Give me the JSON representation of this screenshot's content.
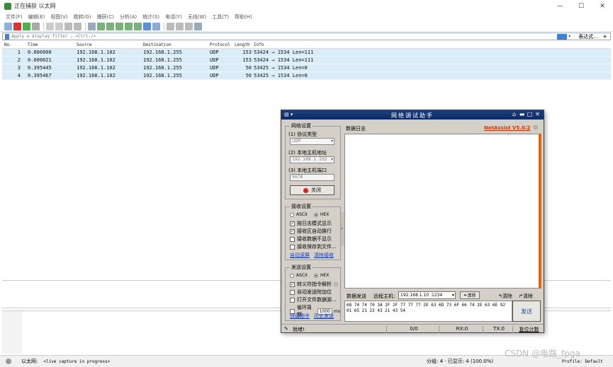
{
  "window": {
    "title": "正在捕获 以太网"
  },
  "menu": [
    "文件(F)",
    "编辑(E)",
    "视图(V)",
    "跳转(G)",
    "捕获(C)",
    "分析(A)",
    "统计(S)",
    "电话(Y)",
    "无线(W)",
    "工具(T)",
    "帮助(H)"
  ],
  "filter": {
    "placeholder": "Apply a display filter … <Ctrl-/>",
    "expr_label": "表达式…",
    "plus": "+"
  },
  "packet_list": {
    "columns": [
      "No.",
      "Time",
      "Source",
      "Destination",
      "Protocol",
      "Length",
      "Info"
    ],
    "rows": [
      {
        "no": "1",
        "time": "0.000000",
        "src": "192.168.1.102",
        "dst": "192.168.1.255",
        "proto": "UDP",
        "len": "153",
        "info": "53424 → 1534 Len=111"
      },
      {
        "no": "2",
        "time": "0.000021",
        "src": "192.168.1.102",
        "dst": "192.168.1.255",
        "proto": "UDP",
        "len": "153",
        "info": "53424 → 1534 Len=111"
      },
      {
        "no": "3",
        "time": "0.395445",
        "src": "192.168.1.102",
        "dst": "192.168.1.255",
        "proto": "UDP",
        "len": "50",
        "info": "53425 → 1534 Len=8"
      },
      {
        "no": "4",
        "time": "0.395467",
        "src": "192.168.1.102",
        "dst": "192.168.1.255",
        "proto": "UDP",
        "len": "50",
        "info": "53425 → 1534 Len=8"
      }
    ]
  },
  "status": {
    "interface": "以太网:",
    "capture": "<live capture in progress>",
    "stats": "分组: 4 · 已显示: 4 (100.0%)",
    "profile": "Profile: Default"
  },
  "watermark": "CSDN @电路_fpga",
  "netassist": {
    "title": "网络调试助手",
    "brand": "NetAssist V5.0.2",
    "net_settings": {
      "legend": "网络设置",
      "protocol_label": "(1) 协议类型",
      "protocol_value": "UDP",
      "local_ip_label": "(2) 本地主机地址",
      "local_ip_value": "192 .168 .1 .102",
      "local_port_label": "(3) 本地主机端口",
      "local_port_value": "5678",
      "close_button": "关闭"
    },
    "recv_settings": {
      "legend": "接收设置",
      "ascii": "ASCII",
      "hex": "HEX",
      "options": [
        "按日志模式显示",
        "接收区自动换行",
        "接收数据不显示",
        "接收保存到文件..."
      ],
      "checked": [
        true,
        true,
        false,
        false
      ],
      "auto_scroll": "自动滚屏",
      "clear_recv": "清除接收"
    },
    "send_settings": {
      "legend": "发送设置",
      "ascii": "ASCII",
      "hex": "HEX",
      "options": [
        "转义符指令解析",
        "自动发送附加位",
        "打开文件数据源...",
        "循环周期"
      ],
      "checked": [
        true,
        false,
        false,
        false
      ],
      "period_value": "1000",
      "period_unit": "ms",
      "shortcut": "快捷指令",
      "history": "历史发送"
    },
    "log_tab": "数据日志",
    "send_tab": "数据发送",
    "remote_label": "远程主机:",
    "remote_value": "192.168.1.10 :1234",
    "clear1": "清除",
    "clear2": "清除",
    "clear3": "清除",
    "send_data": "68 74 74 70 3A 2F 2F 77 77 77 2E 63 6D 73 6F 66 74 2E 63 6E 92 01 65 21 23 43 21 43 54",
    "send_button": "发送",
    "status_ready": "就绪!",
    "status_count": "0/0",
    "status_rx": "RX:0",
    "status_tx": "TX:0",
    "status_reset": "复位计数"
  }
}
